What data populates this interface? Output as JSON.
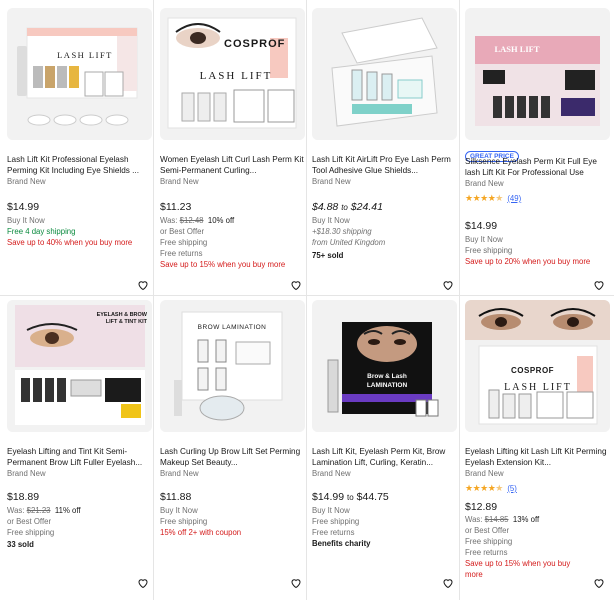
{
  "cards": [
    {
      "title": "Lash Lift Kit Professional Eyelash Perming Kit Including Eye Shields ...",
      "condition": "Brand New",
      "price": "$14.99",
      "buy": "Buy It Now",
      "shipping": "Free 4 day shipping",
      "promo": "Save up to 40% when you buy more",
      "image_label": "LASH LIFT"
    },
    {
      "title": "Women Eyelash Lift Curl Lash Perm Kit Semi-Permanent Curling...",
      "condition": "Brand New",
      "price": "$11.23",
      "was_label": "Was:",
      "was_price": "$12.48",
      "discount": "10% off",
      "best_offer": "or Best Offer",
      "shipping": "Free shipping",
      "returns": "Free returns",
      "promo": "Save up to 15% when you buy more",
      "image_label": "LASH LIFT",
      "brand": "COSPROF"
    },
    {
      "title": "Lash Lift Kit AirLift Pro Eye Lash Perm Tool Adhesive Glue Shields...",
      "condition": "Brand New",
      "price_from": "$4.88",
      "price_to_word": "to",
      "price_to": "$24.41",
      "buy": "Buy It Now",
      "shipping": "+$18.30 shipping",
      "location": "from United Kingdom",
      "sold": "75+ sold"
    },
    {
      "badge": "GREAT PRICE",
      "title": "Silksence Eyelash Perm Kit Full Eye lash Lift Kit For Professional Use",
      "condition": "Brand New",
      "rating": 4.5,
      "reviews": "(49)",
      "price": "$14.99",
      "buy": "Buy It Now",
      "shipping": "Free shipping",
      "promo": "Save up to 20% when you buy more",
      "image_label": "LASH LIFT"
    },
    {
      "title": "Eyelash Lifting and Tint Kit Semi-Permanent Brow Lift Fuller Eyelash...",
      "condition": "Brand New",
      "price": "$18.89",
      "was_label": "Was:",
      "was_price": "$21.23",
      "discount": "11% off",
      "best_offer": "or Best Offer",
      "shipping": "Free shipping",
      "sold": "33 sold",
      "image_label": "EYELASH & BROW LIFT & TINT KIT"
    },
    {
      "title": "Lash Curling Up Brow Lift Set Perming Makeup Set Beauty...",
      "condition": "Brand New",
      "price": "$11.88",
      "buy": "Buy It Now",
      "shipping": "Free shipping",
      "promo": "15% off 2+ with coupon",
      "image_label": "BROW LAMINATION"
    },
    {
      "title": "Lash Lift Kit, Eyelash Perm Kit, Brow Lamination Lift, Curling, Keratin...",
      "condition": "Brand New",
      "price_from": "$14.99",
      "price_to_word": "to",
      "price_to": "$44.75",
      "buy": "Buy It Now",
      "shipping": "Free shipping",
      "returns": "Free returns",
      "benefits": "Benefits charity",
      "image_label": "Brow & Lash LAMINATION"
    },
    {
      "title": "Eyelash Lifting kit Lash Lift Kit Perming Eyelash Extension Kit...",
      "condition": "Brand New",
      "rating": 4.5,
      "reviews": "(5)",
      "price": "$12.89",
      "was_label": "Was:",
      "was_price": "$14.85",
      "discount": "13% off",
      "best_offer": "or Best Offer",
      "shipping": "Free shipping",
      "returns": "Free returns",
      "promo": "Save up to 15% when you buy more",
      "image_label": "LASH LIFT",
      "brand": "COSPROF"
    }
  ],
  "icons": {
    "favorite": "heart-icon",
    "star": "star-icon"
  },
  "colors": {
    "promo": "#d41c1c",
    "shipping_green": "#0a8a3e",
    "link": "#3665f3",
    "star": "#f5a623"
  }
}
